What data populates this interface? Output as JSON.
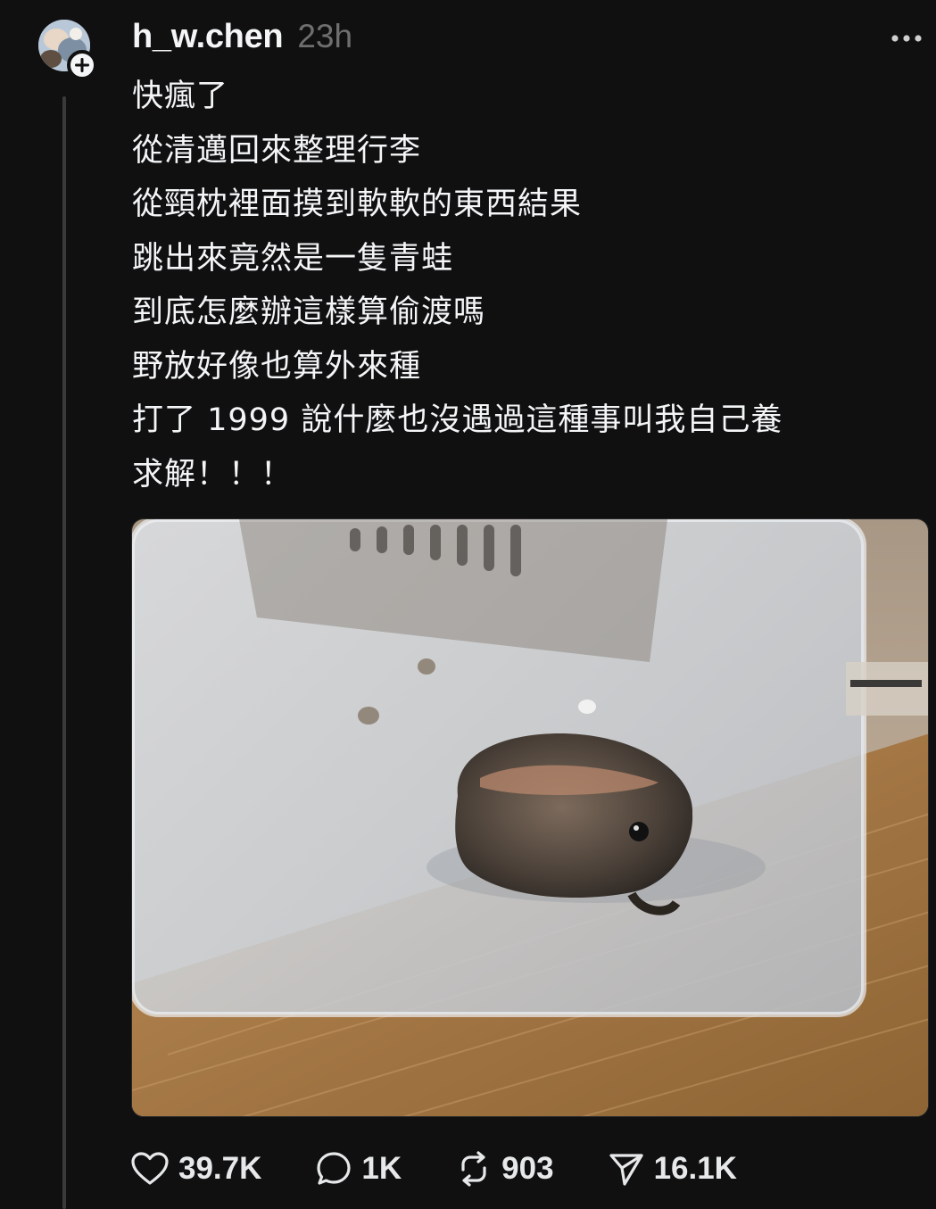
{
  "post": {
    "username": "h_w.chen",
    "time": "23h",
    "lines": [
      "快瘋了",
      "從清邁回來整理行李",
      "從頸枕裡面摸到軟軟的東西結果",
      "跳出來竟然是一隻青蛙",
      "到底怎麼辦這樣算偷渡嗎",
      "野放好像也算外來種",
      "打了 1999 說什麼也沒遇過這種事叫我自己養",
      "求解！！！"
    ],
    "image": {
      "icon": "photo-frog-in-plastic-box"
    }
  },
  "actions": {
    "likes": "39.7K",
    "replies": "1K",
    "reposts": "903",
    "shares": "16.1K"
  },
  "icons": {
    "avatar": "avatar-photo",
    "follow": "plus-icon",
    "more": "more-icon",
    "like": "heart-icon",
    "reply": "comment-icon",
    "repost": "repost-icon",
    "share": "share-icon"
  },
  "colors": {
    "background": "#101010",
    "text": "#f3f5f7",
    "muted": "#6f6f6f",
    "thread_line": "#3a3a3a"
  }
}
